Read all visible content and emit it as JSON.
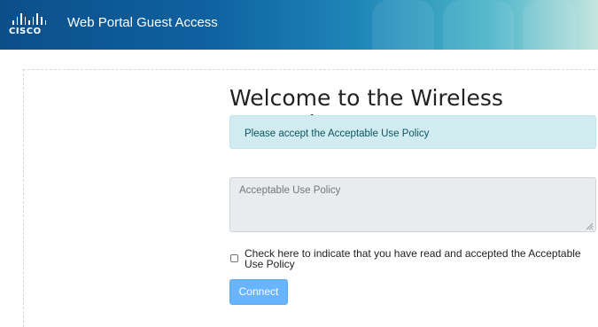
{
  "header": {
    "brand": "CISCO",
    "title": "Web Portal Guest Access"
  },
  "main": {
    "heading": "Welcome to the Wireless Network",
    "notice": "Please accept the Acceptable Use Policy",
    "aup_placeholder": "Acceptable Use Policy",
    "checkbox_label": "Check here to indicate that you have read and accepted the Acceptable Use Policy",
    "checkbox_checked": false,
    "connect_label": "Connect"
  },
  "colors": {
    "header_start": "#0b4f8a",
    "header_end": "#c6e6df",
    "notice_bg": "#d1ecf1",
    "button_bg": "#69b4ff"
  }
}
